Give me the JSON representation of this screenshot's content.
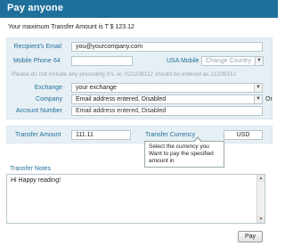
{
  "header": {
    "title": "Pay anyone"
  },
  "max_transfer": {
    "text": "Your maximum Transfer Amount is",
    "amount": "T $ 123.12"
  },
  "form": {
    "recipient_email_label": "Recipient's Email",
    "recipient_email_value": "you@yourcompany.com",
    "mobile_label": "Mobile Phone",
    "mobile_prefix": "64",
    "usa_mobile_label": "USA Mobile",
    "change_country": "Change Country",
    "mobile_hint": "Please do not include any preceding 0's. ie. 021238112 should be entered as 21238112",
    "exchange_label": "Exchange",
    "exchange_value": "your exchange",
    "company_label": "Company",
    "company_value": "Email address entered, Disabled",
    "or_label": "Or",
    "account_label": "Account Number",
    "account_value": "Email address entered, Disabled"
  },
  "transfer": {
    "amount_label": "Transfer Amount",
    "amount_value": "111.11",
    "currency_label": "Transfer Currency",
    "currency_value": "USD",
    "tooltip": "Select the currency you Want to pay the specified amount in"
  },
  "notes": {
    "label": "Transfer Notes",
    "value": "Hi Happy reading!"
  },
  "pay_button": "Pay",
  "colors": {
    "header": "#1f6f9b",
    "panel": "#e6eff4",
    "label": "#1f6f9b"
  }
}
